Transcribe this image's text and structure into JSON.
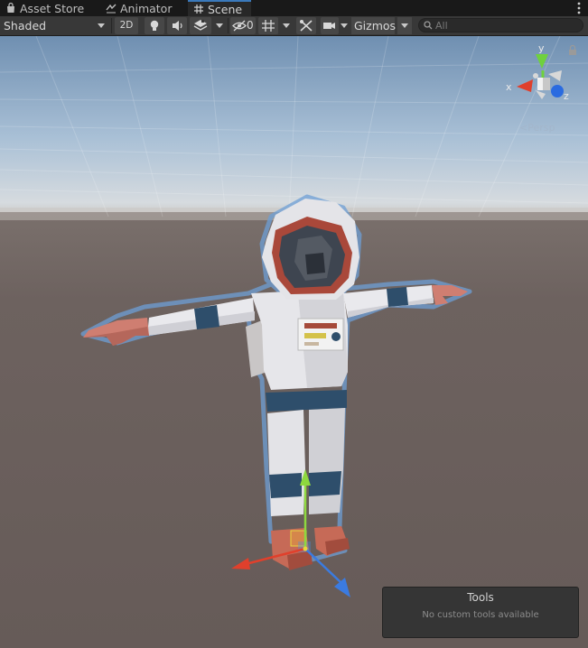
{
  "tabs": [
    {
      "label": "Asset Store",
      "icon": "shopping-bag-icon"
    },
    {
      "label": "Animator",
      "icon": "animator-icon"
    },
    {
      "label": "Scene",
      "icon": "grid-hash-icon",
      "active": true
    }
  ],
  "toolbar": {
    "shading_mode": "Shaded",
    "toggle_2d": "2D",
    "hidden_objects_count": "0",
    "gizmos_label": "Gizmos",
    "search_placeholder": "All",
    "icons": [
      "lightbulb-icon",
      "audio-icon",
      "effects-layers-icon",
      "eye-slash-icon",
      "grid-snap-icon",
      "tools-icon",
      "camera-icon",
      "search-icon"
    ]
  },
  "scene_gizmo": {
    "axis_labels": {
      "x": "x",
      "y": "y",
      "z": "z"
    },
    "projection": "Persp"
  },
  "tools_overlay": {
    "title": "Tools",
    "message": "No custom tools available"
  },
  "colors": {
    "tab_accent": "#3a79bb",
    "axis_x": "#e0402c",
    "axis_y": "#6fd13d",
    "axis_z": "#2a6be0",
    "sky": "#8fb1d1",
    "ground": "#6e6360"
  }
}
